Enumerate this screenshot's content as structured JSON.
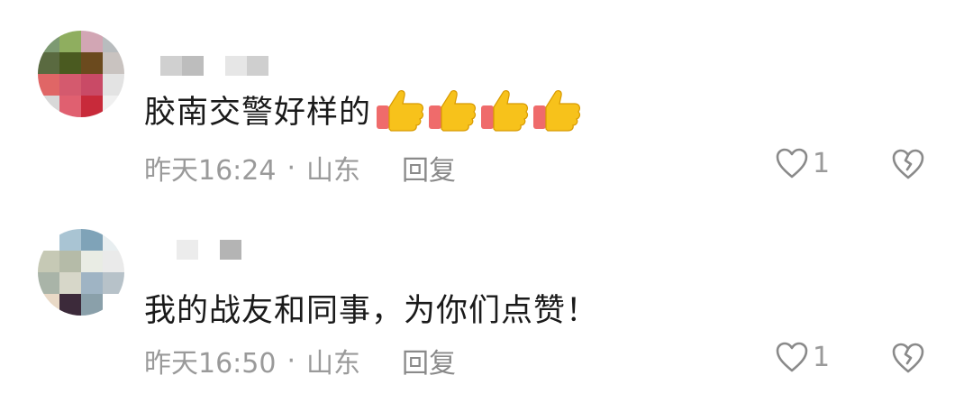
{
  "comments": [
    {
      "text": "胶南交警好样的",
      "emoji_count": 4,
      "time": "昨天16:24",
      "location": "山东",
      "reply_label": "回复",
      "likes": "1",
      "avatar_pixels": [
        "#7d9a72",
        "#8fae5f",
        "#d2a6b4",
        "#b8bcbe",
        "#5a6a40",
        "#4a5a20",
        "#6b4a1e",
        "#c9c3c0",
        "#e06666",
        "#d45a6e",
        "#c94a66",
        "#e3e3e3",
        "#d8d8d8",
        "#e06070",
        "#c82a3a",
        "#f0f0f0"
      ],
      "username_pixels": [
        "#d0d0d0",
        "#bdbdbd",
        "#ffffff",
        "#e6e6e6",
        "#cfcfcf"
      ]
    },
    {
      "text": "我的战友和同事，为你们点赞！",
      "time": "昨天16:50",
      "location": "山东",
      "reply_label": "回复",
      "likes": "1",
      "avatar_pixels": [
        "#ffffff",
        "#a9c4d3",
        "#7fa3b8",
        "#e8eef0",
        "#c6c9b5",
        "#b5bba8",
        "#e9ece4",
        "#eaeaea",
        "#a9b4a8",
        "#d7d7c9",
        "#9fb4c4",
        "#b7c2c9",
        "#e9d9c6",
        "#3c2a3a",
        "#8aa0aa",
        "#ffffff"
      ],
      "username_pixels": [
        "#ececec",
        "#ffffff",
        "#b4b4b4"
      ]
    }
  ],
  "colors": {
    "text": "#1a1a1a",
    "meta": "#9a9a9a",
    "icon": "#8a8a8a",
    "thumb_yellow": "#f7c21b",
    "thumb_cuff": "#ef6b6b"
  },
  "icons": {
    "like": "heart-outline-icon",
    "dislike": "broken-heart-icon",
    "emoji": "thumbs-up-emoji"
  }
}
